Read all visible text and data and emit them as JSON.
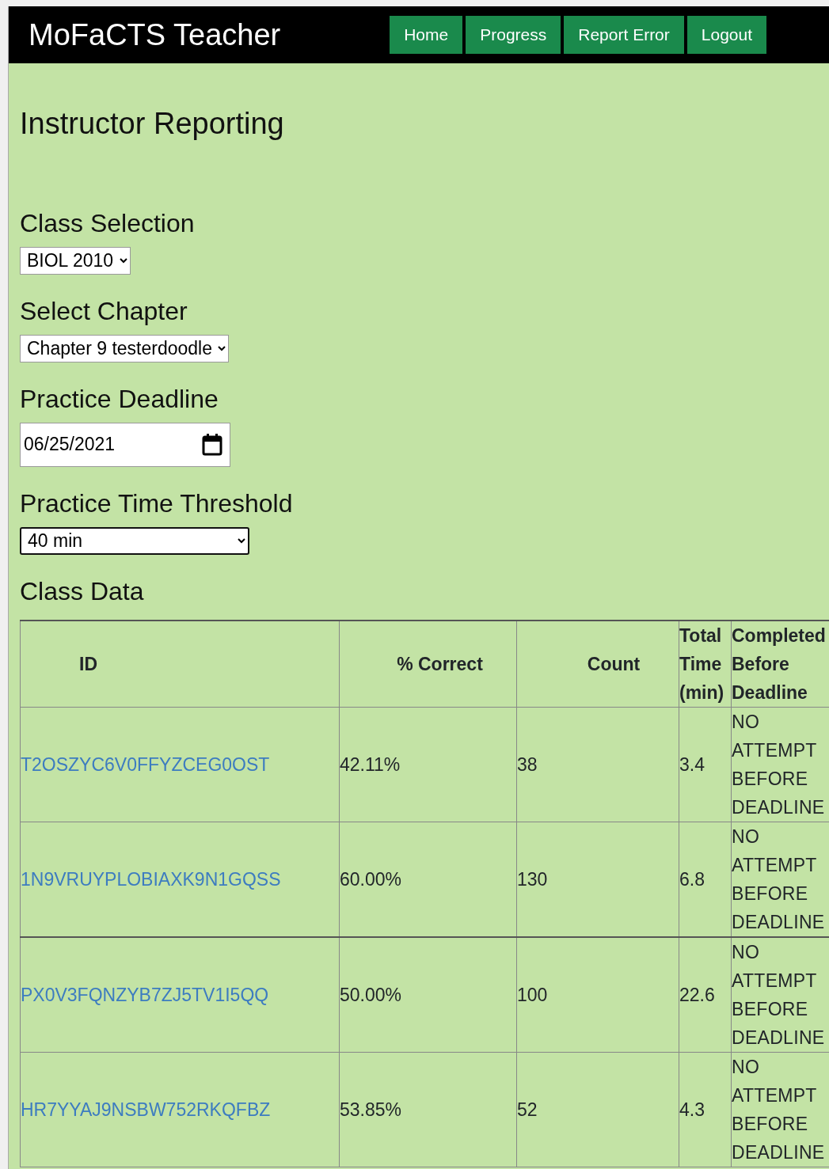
{
  "header": {
    "title": "MoFaCTS Teacher",
    "nav": [
      "Home",
      "Progress",
      "Report Error",
      "Logout"
    ]
  },
  "page_title": "Instructor Reporting",
  "controls": [
    {
      "kind": "select",
      "label": "Class Selection",
      "value": "BIOL 2010",
      "focused": false
    },
    {
      "kind": "select",
      "label": "Select Chapter",
      "value": "Chapter 9 testerdoodle",
      "focused": false
    },
    {
      "kind": "date",
      "label": "Practice Deadline",
      "value": "06/25/2021",
      "focused": false
    },
    {
      "kind": "select",
      "label": "Practice Time Threshold",
      "value": "40 min",
      "focused": true
    }
  ],
  "table": {
    "title": "Class Data",
    "columns": [
      "ID",
      "% Correct",
      "Count",
      "Total Time (min)",
      "Completed Before Deadline"
    ],
    "rows": [
      [
        "T2OSZYC6V0FFYZCEG0OST",
        "42.11%",
        "38",
        "3.4",
        "NO ATTEMPT BEFORE DEADLINE"
      ],
      [
        "1N9VRUYPLOBIAXK9N1GQSS",
        "60.00%",
        "130",
        "6.8",
        "NO ATTEMPT BEFORE DEADLINE"
      ],
      [
        "PX0V3FQNZYB7ZJ5TV1I5QQ",
        "50.00%",
        "100",
        "22.6",
        "NO ATTEMPT BEFORE DEADLINE"
      ],
      [
        "HR7YYAJ9NSBW752RKQFBZ",
        "53.85%",
        "52",
        "4.3",
        "NO ATTEMPT BEFORE DEADLINE"
      ]
    ]
  }
}
